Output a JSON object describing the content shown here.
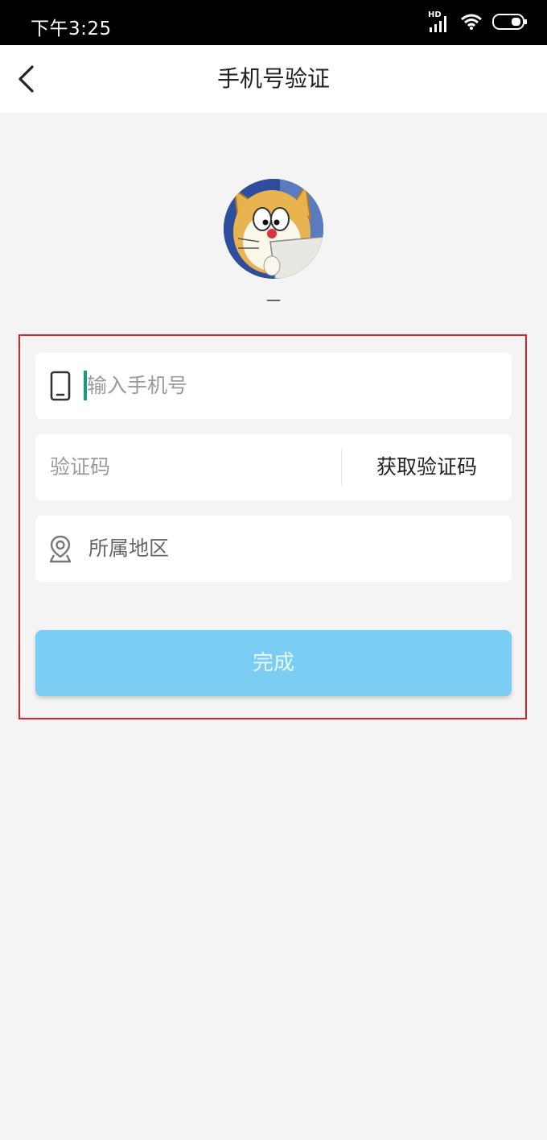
{
  "status_bar": {
    "time": "下午3:25",
    "network_label": "HD"
  },
  "nav": {
    "title": "手机号验证"
  },
  "profile": {
    "name": "一"
  },
  "form": {
    "phone": {
      "placeholder": "输入手机号"
    },
    "code": {
      "placeholder": "验证码",
      "button_label": "获取验证码"
    },
    "region": {
      "label": "所属地区"
    },
    "submit_label": "完成"
  },
  "colors": {
    "accent_button": "#7ccdf4",
    "caret": "#169b7e",
    "highlight_frame": "#d9212c"
  }
}
